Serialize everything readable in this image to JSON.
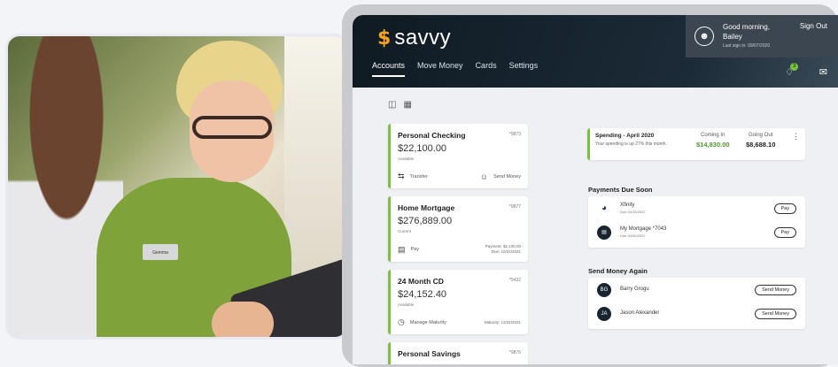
{
  "brand": {
    "name": "savvy",
    "mark": "$"
  },
  "nav": [
    "Accounts",
    "Move Money",
    "Cards",
    "Settings"
  ],
  "user": {
    "greeting": "Good morning,",
    "name": "Bailey",
    "last_signin": "Last sign in: 09/07/2020",
    "signout": "Sign Out",
    "notifications": "3"
  },
  "name_badge": "Gemma",
  "accounts": [
    {
      "name": "Personal Checking",
      "number": "*9873",
      "balance": "$22,100.00",
      "status": "Available",
      "action1": "Transfer",
      "action2": "Send Money"
    },
    {
      "name": "Home Mortgage",
      "number": "*9877",
      "balance": "$276,889.00",
      "status": "Current",
      "action1": "Pay",
      "detail1": "Payment: $2,100.00",
      "detail2": "Due: 10/31/2021"
    },
    {
      "name": "24 Month CD",
      "number": "*5432",
      "balance": "$24,152.40",
      "status": "Available",
      "action1": "Manage Maturity",
      "detail1": "Maturity: 12/31/2021"
    },
    {
      "name": "Personal Savings",
      "number": "*9876"
    }
  ],
  "spending": {
    "title": "Spending - April 2020",
    "subtitle": "Your spending is up 27% this month.",
    "in_label": "Coming In",
    "in_value": "$14,830.00",
    "out_label": "Going Out",
    "out_value": "$8,688.10"
  },
  "payments": {
    "title": "Payments Due Soon",
    "items": [
      {
        "name": "Xfinity",
        "due": "Due 04/15/2022",
        "action": "Pay"
      },
      {
        "name": "My Mortgage *7043",
        "due": "Due 04/30/2022",
        "action": "Pay"
      }
    ]
  },
  "send_again": {
    "title": "Send Money Again",
    "items": [
      {
        "initials": "BG",
        "name": "Barry Grogu",
        "action": "Send Money"
      },
      {
        "initials": "JA",
        "name": "Jason Alexander",
        "action": "Send Money"
      }
    ]
  },
  "colors": {
    "accent": "#7cc040",
    "header": "#0f1a22",
    "in_value": "#4a9a2a",
    "out_value": "#222222"
  }
}
